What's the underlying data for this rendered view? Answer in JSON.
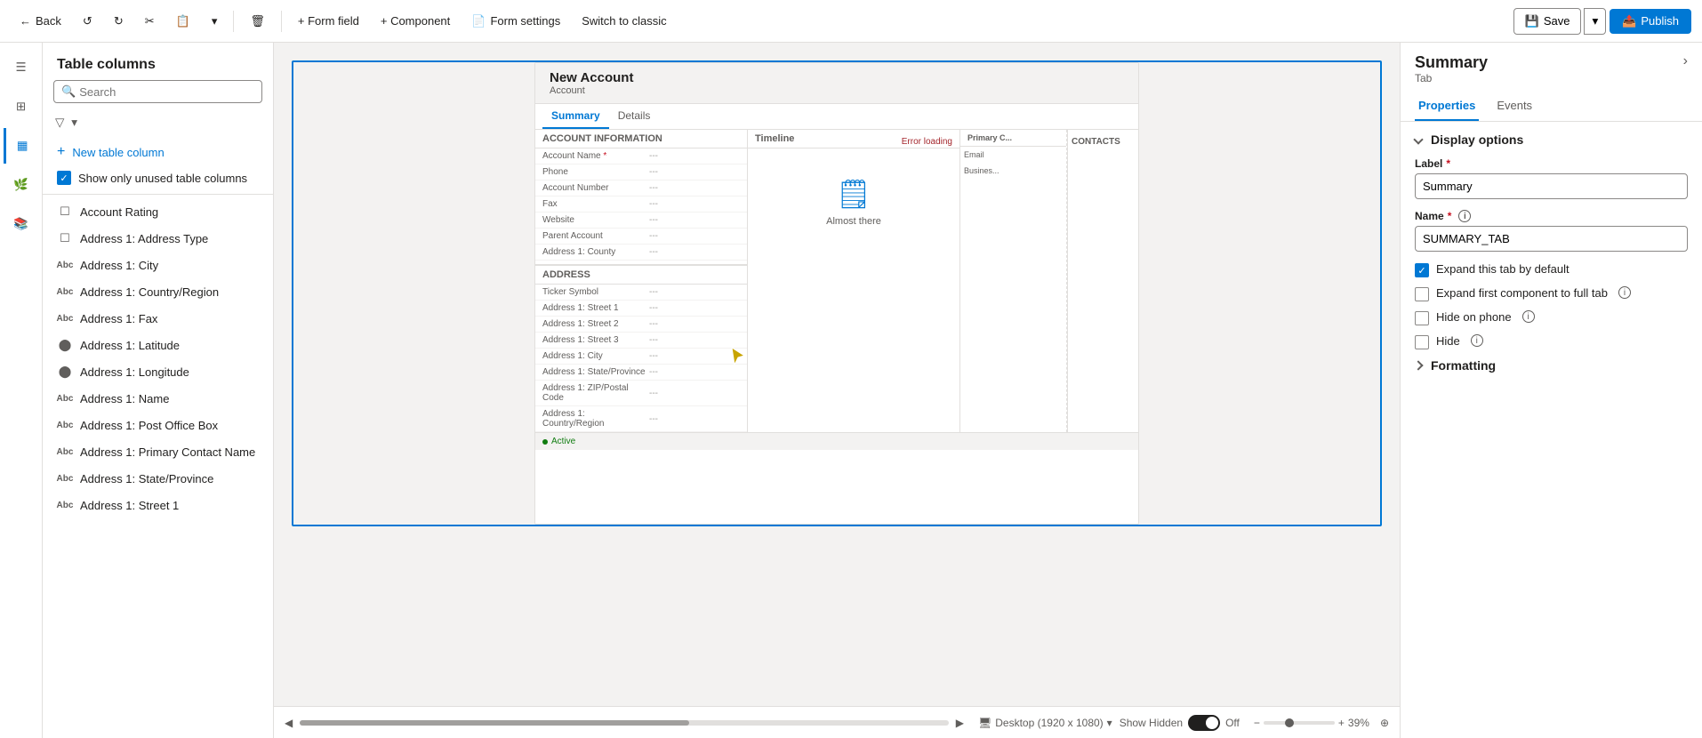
{
  "toolbar": {
    "back_label": "Back",
    "form_field_label": "+ Form field",
    "component_label": "+ Component",
    "form_settings_label": "Form settings",
    "switch_classic_label": "Switch to classic",
    "save_label": "Save",
    "publish_label": "Publish"
  },
  "left_nav": {
    "items": [
      {
        "name": "menu-icon",
        "symbol": "☰"
      },
      {
        "name": "components-icon",
        "label": "Components",
        "symbol": "⊞"
      },
      {
        "name": "table-columns-icon",
        "label": "Table columns",
        "symbol": "▦"
      },
      {
        "name": "tree-view-icon",
        "label": "Tree view",
        "symbol": "🌲"
      },
      {
        "name": "form-libraries-icon",
        "label": "Form libraries",
        "symbol": "📚"
      }
    ]
  },
  "panel": {
    "title": "Table columns",
    "search_placeholder": "Search",
    "new_column_label": "New table column",
    "show_unused_label": "Show only unused table columns",
    "items": [
      {
        "icon": "field-icon",
        "label": "Account Rating"
      },
      {
        "icon": "field-icon",
        "label": "Address 1: Address Type"
      },
      {
        "icon": "text-icon",
        "label": "Address 1: City"
      },
      {
        "icon": "text-icon",
        "label": "Address 1: Country/Region"
      },
      {
        "icon": "text-icon",
        "label": "Address 1: Fax",
        "has_more": true
      },
      {
        "icon": "circle-icon",
        "label": "Address 1: Latitude"
      },
      {
        "icon": "circle-icon",
        "label": "Address 1: Longitude"
      },
      {
        "icon": "text-icon",
        "label": "Address 1: Name"
      },
      {
        "icon": "text-icon",
        "label": "Address 1: Post Office Box"
      },
      {
        "icon": "text-icon",
        "label": "Address 1: Primary Contact Name"
      },
      {
        "icon": "text-icon",
        "label": "Address 1: State/Province"
      },
      {
        "icon": "text-icon",
        "label": "Address 1: Street 1"
      }
    ]
  },
  "form_preview": {
    "title": "New Account",
    "subtitle": "Account",
    "tabs": [
      "Summary",
      "Details"
    ],
    "active_tab": "Summary",
    "account_section": {
      "header": "ACCOUNT INFORMATION",
      "rows": [
        {
          "label": "Account Name",
          "value": "---",
          "required": true
        },
        {
          "label": "Phone",
          "value": "---"
        },
        {
          "label": "Account Number",
          "value": "---"
        },
        {
          "label": "Fax",
          "value": "---"
        },
        {
          "label": "Website",
          "value": "---"
        },
        {
          "label": "Parent Account",
          "value": "---"
        },
        {
          "label": "Address 1: County",
          "value": "---"
        }
      ]
    },
    "timeline_section": {
      "header": "Timeline",
      "almost_there": "Almost there"
    },
    "address_section": {
      "header": "ADDRESS",
      "rows": [
        {
          "label": "Ticker Symbol",
          "value": "---"
        },
        {
          "label": "Address 1: Street 1",
          "value": "---"
        },
        {
          "label": "Address 1: Street 2",
          "value": "---"
        },
        {
          "label": "Address 1: Street 3",
          "value": "---"
        },
        {
          "label": "Address 1: City",
          "value": "---"
        },
        {
          "label": "Address 1: State/Province",
          "value": "---"
        },
        {
          "label": "Address 1: ZIP/Postal Code",
          "value": "---"
        },
        {
          "label": "Address 1: Country/Region",
          "value": "---"
        }
      ]
    },
    "contacts_col": "CONTACTS",
    "status": "Active",
    "error": "Error loading"
  },
  "bottom_bar": {
    "desktop_label": "Desktop (1920 x 1080)",
    "show_hidden_label": "Show Hidden",
    "toggle_state": "Off",
    "zoom_label": "39%"
  },
  "right_panel": {
    "title": "Summary",
    "subtitle": "Tab",
    "tabs": [
      "Properties",
      "Events"
    ],
    "active_tab": "Properties",
    "display_options": {
      "header": "Display options",
      "label_field": {
        "label": "Label",
        "required": true,
        "value": "Summary"
      },
      "name_field": {
        "label": "Name",
        "required": true,
        "value": "SUMMARY_TAB"
      },
      "checkboxes": [
        {
          "id": "expand-tab",
          "label": "Expand this tab by default",
          "checked": true,
          "has_info": false
        },
        {
          "id": "expand-first",
          "label": "Expand first component to full tab",
          "checked": false,
          "has_info": true
        },
        {
          "id": "hide-phone",
          "label": "Hide on phone",
          "checked": false,
          "has_info": true
        },
        {
          "id": "hide",
          "label": "Hide",
          "checked": false,
          "has_info": true
        }
      ]
    },
    "formatting": {
      "header": "Formatting"
    }
  }
}
